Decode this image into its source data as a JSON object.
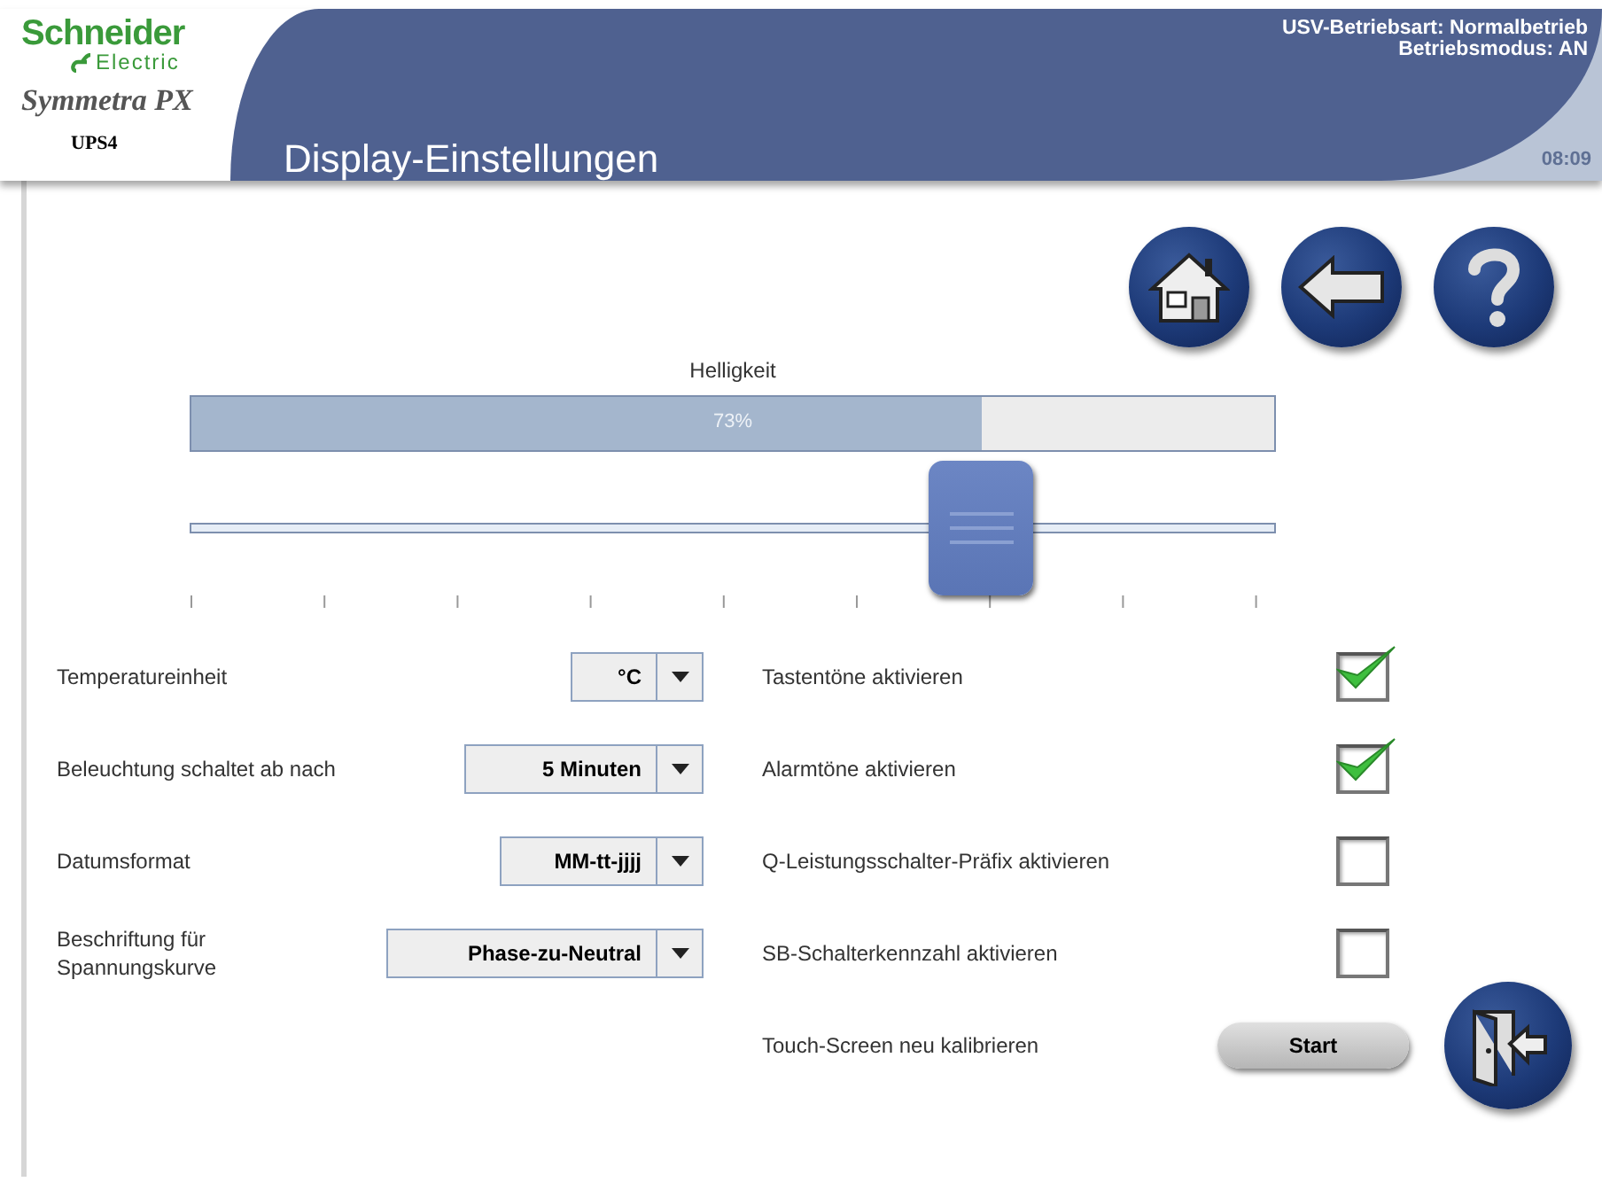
{
  "header": {
    "brand": "Schneider",
    "brand_sub": "Electric",
    "product": "Symmetra PX",
    "device": "UPS4",
    "title": "Display-Einstellungen",
    "status": [
      "USV-Betriebsart: Normalbetrieb",
      "Betriebsmodus: AN"
    ],
    "time": "08:09"
  },
  "nav_buttons": [
    {
      "kind": "home"
    },
    {
      "kind": "back"
    },
    {
      "kind": "help"
    }
  ],
  "brightness": {
    "label": "Helligkeit",
    "level": 0.73,
    "reading": "73%"
  },
  "dropdowns": [
    {
      "label": "Temperatureinheit",
      "value": "°C"
    },
    {
      "label": "Beleuchtung schaltet ab nach",
      "value": "5 Minuten"
    },
    {
      "label": "Datumsformat",
      "value": "MM-tt-jjjj"
    },
    {
      "label": "Beschriftung für Spannungskurve",
      "value": "Phase-zu-Neutral"
    }
  ],
  "checkboxes": [
    {
      "label": "Tastentöne aktivieren",
      "checked": true
    },
    {
      "label": "Alarmtöne aktivieren",
      "checked": true
    },
    {
      "label": "Q-Leistungsschalter-Präfix aktivieren",
      "checked": false
    },
    {
      "label": "SB-Schalterkennzahl aktivieren",
      "checked": false
    }
  ],
  "calibrate": {
    "label": "Touch-Screen neu kalibrieren",
    "button": "Start"
  },
  "exit_button": {
    "kind": "exit"
  }
}
